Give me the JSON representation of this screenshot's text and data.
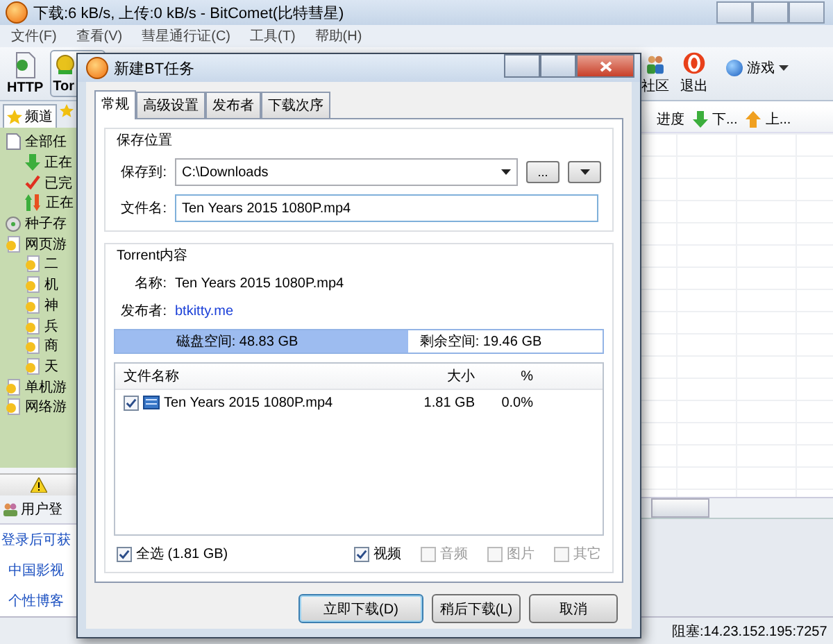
{
  "window": {
    "title": "下载:6 kB/s, 上传:0 kB/s - BitComet(比特彗星)"
  },
  "menu": [
    "文件(F)",
    "查看(V)",
    "彗星通行证(C)",
    "工具(T)",
    "帮助(H)"
  ],
  "toolbar": {
    "left": [
      {
        "label": "HTTP",
        "kind": "http"
      },
      {
        "label": "Tor",
        "kind": "torrent"
      }
    ],
    "right": [
      {
        "label": "社区",
        "kind": "community"
      },
      {
        "label": "退出",
        "kind": "exit"
      }
    ],
    "games": "游戏"
  },
  "sidebar": {
    "tab": "频道",
    "tree": [
      {
        "label": "全部任",
        "kind": "page",
        "children": [
          {
            "label": "正在",
            "kind": "down"
          },
          {
            "label": "已完",
            "kind": "done"
          },
          {
            "label": "正在",
            "kind": "updown"
          }
        ]
      },
      {
        "label": "种子存",
        "kind": "seed"
      },
      {
        "label": "网页游",
        "kind": "game",
        "children": [
          {
            "label": "二",
            "kind": "game"
          },
          {
            "label": "机",
            "kind": "game"
          },
          {
            "label": "神",
            "kind": "game"
          },
          {
            "label": "兵",
            "kind": "game"
          },
          {
            "label": "商",
            "kind": "game"
          },
          {
            "label": "天",
            "kind": "game"
          }
        ]
      },
      {
        "label": "单机游",
        "kind": "game"
      },
      {
        "label": "网络游",
        "kind": "game"
      }
    ]
  },
  "login": {
    "title": "用户登",
    "links": [
      "登录后可获",
      "中国影视",
      "个性博客"
    ]
  },
  "task_table": {
    "columns": [
      {
        "label": "进度",
        "kind": "plain"
      },
      {
        "label": "下...",
        "kind": "down"
      },
      {
        "label": "上...",
        "kind": "up"
      }
    ]
  },
  "status_bar": "阻塞:14.23.152.195:7257",
  "dialog": {
    "title": "新建BT任务",
    "tabs": [
      {
        "label": "常规",
        "selected": true
      },
      {
        "label": "高级设置",
        "selected": false
      },
      {
        "label": "发布者",
        "selected": false
      },
      {
        "label": "下载次序",
        "selected": false
      }
    ],
    "save_group": {
      "title": "保存位置",
      "save_to_label": "保存到:",
      "save_to": "C:\\Downloads",
      "browse": "...",
      "filename_label": "文件名:",
      "filename": "Ten Years 2015 1080P.mp4"
    },
    "torrent_group": {
      "title": "Torrent内容",
      "name_label": "名称:",
      "name": "Ten Years 2015 1080P.mp4",
      "publisher_label": "发布者:",
      "publisher": "btkitty.me",
      "disk": {
        "total": "磁盘空间: 48.83 GB",
        "free": "剩余空间: 19.46 GB",
        "level": 0.6
      },
      "files": {
        "columns": [
          "文件名称",
          "大小",
          "%"
        ],
        "rows": [
          {
            "name": "Ten Years 2015 1080P.mp4",
            "size": "1.81 GB",
            "percent": "0.0%",
            "checked": true
          }
        ]
      },
      "select_all": {
        "label": "全选 (1.81 GB)",
        "checked": true
      },
      "filters": [
        {
          "label": "视频",
          "checked": true,
          "disabled": false
        },
        {
          "label": "音频",
          "checked": false,
          "disabled": true
        },
        {
          "label": "图片",
          "checked": false,
          "disabled": true
        },
        {
          "label": "其它",
          "checked": false,
          "disabled": true
        }
      ]
    },
    "buttons": [
      "立即下载(D)",
      "稍后下载(L)",
      "取消"
    ]
  }
}
